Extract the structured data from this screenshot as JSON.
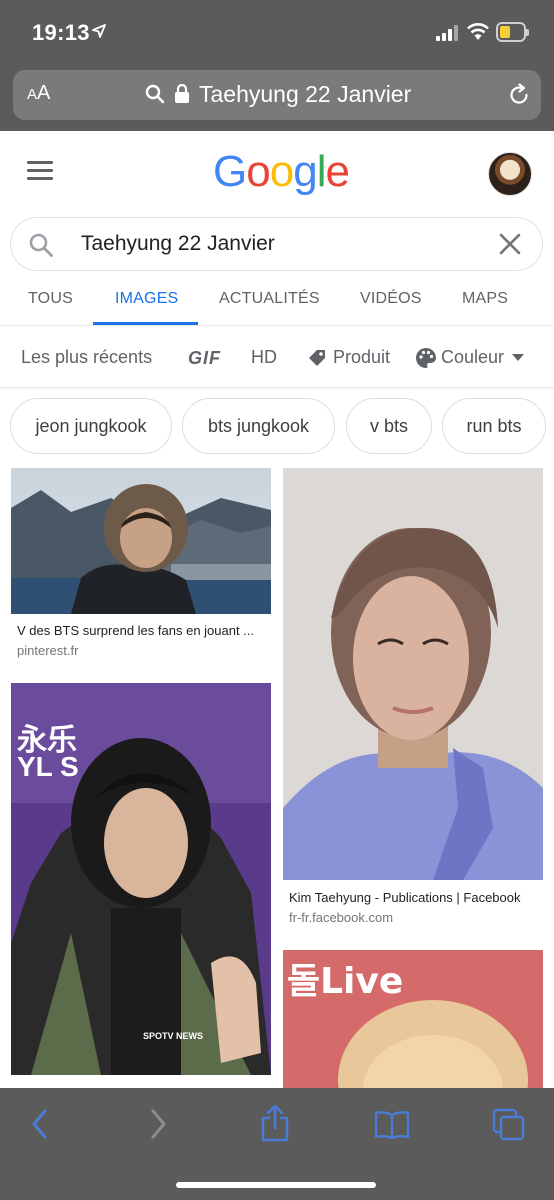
{
  "status": {
    "time": "19:13"
  },
  "browser": {
    "text_size_label": "A",
    "text_size_label_big": "A",
    "url_text": "Taehyung 22 Janvier"
  },
  "google": {
    "logo_letters": [
      "G",
      "o",
      "o",
      "g",
      "l",
      "e"
    ],
    "query": "Taehyung 22 Janvier",
    "tabs": [
      {
        "label": "TOUS",
        "active": false
      },
      {
        "label": "IMAGES",
        "active": true
      },
      {
        "label": "ACTUALITÉS",
        "active": false
      },
      {
        "label": "VIDÉOS",
        "active": false
      },
      {
        "label": "MAPS",
        "active": false
      }
    ],
    "filters": {
      "recent": "Les plus récents",
      "gif": "GIF",
      "hd": "HD",
      "product": "Produit",
      "color": "Couleur"
    },
    "chips": [
      "jeon jungkook",
      "bts jungkook",
      "v bts",
      "run bts"
    ],
    "results": [
      {
        "caption": "V des BTS surprend les fans en jouant ...",
        "domain": "pinterest.fr"
      },
      {
        "caption": "Kim Taehyung - Publications | Facebook",
        "domain": "fr-fr.facebook.com"
      },
      {
        "caption": "",
        "domain": ""
      },
      {
        "caption": "",
        "domain": ""
      }
    ],
    "photo_text": {
      "photo3_sign_line1": "永乐",
      "photo3_sign_line2": "YL S",
      "photo3_watermark": "SPOTV NEWS",
      "photo4_sign": "돌Live"
    }
  },
  "colors": {
    "chrome": "#5b5b5b",
    "accent": "#1a73e8",
    "toolbar_icon": "#4a7bd8",
    "toolbar_icon_disabled": "#8c8c8c"
  },
  "toolbar_icons": [
    "back-icon",
    "forward-icon",
    "share-icon",
    "bookmarks-icon",
    "tabs-icon"
  ]
}
